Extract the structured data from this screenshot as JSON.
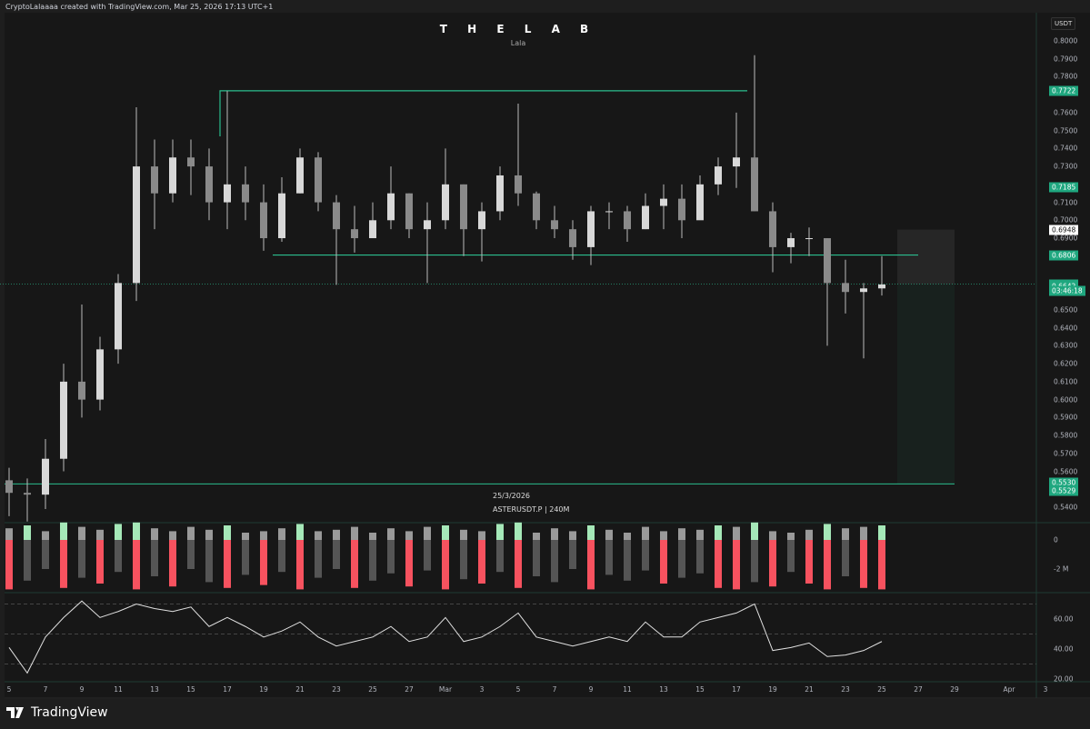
{
  "header": {
    "credit": "CryptoLalaaaa created with TradingView.com, Mar 25, 2026 17:13 UTC+1"
  },
  "chart_data": {
    "type": "candlestick",
    "title": "T H E L A B",
    "subtitle": "Lala",
    "symbol_info": "ASTERUSDT.P | 240M",
    "date_label": "25/3/2026",
    "currency": "USDT",
    "ylim": [
      0.535,
      0.805
    ],
    "price_ticks": [
      "0.8000",
      "0.7900",
      "0.7800",
      "0.7600",
      "0.7500",
      "0.7400",
      "0.7300",
      "0.7100",
      "0.7000",
      "0.6900",
      "0.6500",
      "0.6400",
      "0.6300",
      "0.6200",
      "0.6100",
      "0.6000",
      "0.5900",
      "0.5800",
      "0.5700",
      "0.5600",
      "0.5400"
    ],
    "time_ticks": [
      {
        "label": "5",
        "day": 0
      },
      {
        "label": "7",
        "day": 2
      },
      {
        "label": "9",
        "day": 4
      },
      {
        "label": "11",
        "day": 6
      },
      {
        "label": "13",
        "day": 8
      },
      {
        "label": "15",
        "day": 10
      },
      {
        "label": "17",
        "day": 12
      },
      {
        "label": "19",
        "day": 14
      },
      {
        "label": "21",
        "day": 16
      },
      {
        "label": "23",
        "day": 18
      },
      {
        "label": "25",
        "day": 20
      },
      {
        "label": "27",
        "day": 22
      },
      {
        "label": "Mar",
        "day": 24
      },
      {
        "label": "3",
        "day": 26
      },
      {
        "label": "5",
        "day": 28
      },
      {
        "label": "7",
        "day": 30
      },
      {
        "label": "9",
        "day": 32
      },
      {
        "label": "11",
        "day": 34
      },
      {
        "label": "13",
        "day": 36
      },
      {
        "label": "15",
        "day": 38
      },
      {
        "label": "17",
        "day": 40
      },
      {
        "label": "19",
        "day": 42
      },
      {
        "label": "21",
        "day": 44
      },
      {
        "label": "23",
        "day": 46
      },
      {
        "label": "25",
        "day": 48
      },
      {
        "label": "27",
        "day": 50
      },
      {
        "label": "29",
        "day": 52
      },
      {
        "label": "Apr",
        "day": 55
      },
      {
        "label": "3",
        "day": 57
      }
    ],
    "candles_daily_ohlc": [
      [
        0.555,
        0.562,
        0.535,
        0.548
      ],
      [
        0.548,
        0.556,
        0.532,
        0.547
      ],
      [
        0.547,
        0.578,
        0.539,
        0.567
      ],
      [
        0.567,
        0.62,
        0.56,
        0.61
      ],
      [
        0.61,
        0.653,
        0.59,
        0.6
      ],
      [
        0.6,
        0.635,
        0.594,
        0.628
      ],
      [
        0.628,
        0.67,
        0.62,
        0.665
      ],
      [
        0.665,
        0.763,
        0.655,
        0.73
      ],
      [
        0.73,
        0.745,
        0.695,
        0.715
      ],
      [
        0.715,
        0.745,
        0.71,
        0.735
      ],
      [
        0.735,
        0.745,
        0.714,
        0.73
      ],
      [
        0.73,
        0.74,
        0.7,
        0.71
      ],
      [
        0.71,
        0.7722,
        0.695,
        0.72
      ],
      [
        0.72,
        0.73,
        0.7,
        0.71
      ],
      [
        0.71,
        0.72,
        0.683,
        0.69
      ],
      [
        0.69,
        0.724,
        0.688,
        0.715
      ],
      [
        0.715,
        0.74,
        0.715,
        0.735
      ],
      [
        0.735,
        0.738,
        0.705,
        0.71
      ],
      [
        0.71,
        0.714,
        0.664,
        0.695
      ],
      [
        0.695,
        0.708,
        0.682,
        0.69
      ],
      [
        0.69,
        0.71,
        0.69,
        0.7
      ],
      [
        0.7,
        0.73,
        0.695,
        0.715
      ],
      [
        0.715,
        0.715,
        0.69,
        0.695
      ],
      [
        0.695,
        0.71,
        0.665,
        0.7
      ],
      [
        0.7,
        0.74,
        0.695,
        0.72
      ],
      [
        0.72,
        0.72,
        0.68,
        0.695
      ],
      [
        0.695,
        0.71,
        0.677,
        0.705
      ],
      [
        0.705,
        0.73,
        0.7,
        0.725
      ],
      [
        0.725,
        0.765,
        0.708,
        0.715
      ],
      [
        0.715,
        0.716,
        0.695,
        0.7
      ],
      [
        0.7,
        0.708,
        0.69,
        0.695
      ],
      [
        0.695,
        0.7,
        0.678,
        0.685
      ],
      [
        0.685,
        0.708,
        0.675,
        0.705
      ],
      [
        0.705,
        0.71,
        0.695,
        0.705
      ],
      [
        0.705,
        0.708,
        0.688,
        0.695
      ],
      [
        0.695,
        0.715,
        0.695,
        0.708
      ],
      [
        0.708,
        0.72,
        0.695,
        0.712
      ],
      [
        0.712,
        0.72,
        0.69,
        0.7
      ],
      [
        0.7,
        0.725,
        0.71,
        0.72
      ],
      [
        0.72,
        0.735,
        0.714,
        0.73
      ],
      [
        0.73,
        0.76,
        0.718,
        0.735
      ],
      [
        0.735,
        0.792,
        0.705,
        0.705
      ],
      [
        0.705,
        0.71,
        0.671,
        0.685
      ],
      [
        0.685,
        0.693,
        0.676,
        0.69
      ],
      [
        0.69,
        0.696,
        0.68,
        0.69
      ],
      [
        0.69,
        0.69,
        0.63,
        0.665
      ],
      [
        0.665,
        0.678,
        0.648,
        0.66
      ],
      [
        0.66,
        0.665,
        0.623,
        0.662
      ],
      [
        0.662,
        0.68,
        0.658,
        0.6642
      ]
    ],
    "volume_delta_millions": {
      "buy": [
        0.8,
        1.0,
        0.6,
        1.2,
        0.9,
        0.7,
        1.1,
        1.2,
        0.8,
        0.6,
        0.9,
        0.7,
        1.0,
        0.5,
        0.6,
        0.8,
        1.1,
        0.6,
        0.7,
        0.9,
        0.5,
        0.8,
        0.6,
        0.9,
        1.0,
        0.7,
        0.6,
        1.1,
        1.2,
        0.5,
        0.8,
        0.6,
        1.0,
        0.7,
        0.5,
        0.9,
        0.6,
        0.8,
        0.7,
        1.0,
        0.9,
        1.2,
        0.6,
        0.5,
        0.7,
        1.1,
        0.8,
        0.9,
        1.0
      ],
      "sell": [
        -3.4,
        -2.8,
        -2.0,
        -3.3,
        -2.6,
        -3.0,
        -2.2,
        -3.4,
        -2.5,
        -3.2,
        -2.0,
        -2.9,
        -3.3,
        -2.4,
        -3.1,
        -2.2,
        -3.4,
        -2.6,
        -2.0,
        -3.3,
        -2.8,
        -2.3,
        -3.2,
        -2.1,
        -3.4,
        -2.7,
        -3.0,
        -2.2,
        -3.3,
        -2.5,
        -2.9,
        -2.0,
        -3.4,
        -2.4,
        -2.8,
        -2.1,
        -3.0,
        -2.6,
        -2.3,
        -3.3,
        -3.4,
        -2.9,
        -3.2,
        -2.2,
        -3.0,
        -3.4,
        -2.5,
        -3.3,
        -3.4
      ],
      "ticks": [
        "0",
        "-2 M"
      ]
    },
    "rsi": {
      "values": [
        41,
        24,
        48,
        61,
        72,
        61,
        65,
        70,
        67,
        65,
        68,
        55,
        61,
        55,
        48,
        52,
        58,
        48,
        42,
        45,
        48,
        55,
        45,
        48,
        61,
        45,
        48,
        55,
        64,
        48,
        45,
        42,
        45,
        48,
        45,
        58,
        48,
        48,
        58,
        61,
        64,
        70,
        39,
        41,
        44,
        35,
        36,
        39,
        45
      ],
      "ticks": [
        "60.00",
        "40.00",
        "20.00"
      ],
      "levels": [
        70,
        50,
        30
      ]
    },
    "drawings": {
      "range_high": 0.7722,
      "range_low": 0.6806,
      "target": 0.553,
      "position_top": 0.6948,
      "current_price": 0.6643
    },
    "badges": [
      {
        "value": "0.7722",
        "price": 0.7722,
        "style": "green"
      },
      {
        "value": "0.7185",
        "price": 0.7185,
        "style": "green"
      },
      {
        "value": "0.6948",
        "price": 0.6948,
        "style": "white"
      },
      {
        "value": "0.6806",
        "price": 0.6806,
        "style": "green"
      },
      {
        "value": "0.6643",
        "price": 0.6643,
        "style": "green"
      },
      {
        "value": "0.6642",
        "price": 0.663,
        "style": "green"
      },
      {
        "value": "03:46:18",
        "price": 0.6606,
        "style": "green"
      },
      {
        "value": "0.5530",
        "price": 0.5538,
        "style": "green"
      },
      {
        "value": "0.5529",
        "price": 0.549,
        "style": "green"
      }
    ],
    "colors": {
      "accent": "#2bbd8e",
      "candle": "#d8d8d8",
      "sell_strong": "#f7525f",
      "buy_strong": "#a5e8b8"
    }
  },
  "footer": {
    "brand": "TradingView"
  }
}
